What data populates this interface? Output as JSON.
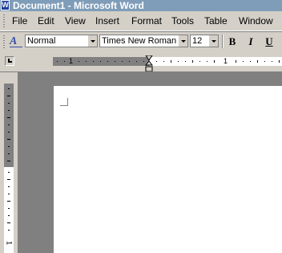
{
  "title_bar": {
    "title": "Document1 - Microsoft Word",
    "app_icon": "word-document-icon",
    "app_icon_glyph": "W",
    "background": "#7f9db9"
  },
  "menu_bar": {
    "items": [
      {
        "label": "File"
      },
      {
        "label": "Edit"
      },
      {
        "label": "View"
      },
      {
        "label": "Insert"
      },
      {
        "label": "Format"
      },
      {
        "label": "Tools"
      },
      {
        "label": "Table"
      },
      {
        "label": "Window"
      }
    ]
  },
  "formatting_toolbar": {
    "styles_icon": "styles-and-formatting-icon",
    "styles_icon_glyph": "A",
    "style": "Normal",
    "font": "Times New Roman",
    "font_size": "12",
    "bold_label": "B",
    "italic_label": "I",
    "underline_label": "U"
  },
  "ruler": {
    "tab_selector_icon": "left-tab-icon",
    "horizontal_labels": [
      "1",
      "1"
    ],
    "vertical_labels": [
      "1"
    ]
  },
  "colors": {
    "chrome": "#d4d0c8",
    "workspace": "#808080",
    "page": "#ffffff"
  }
}
